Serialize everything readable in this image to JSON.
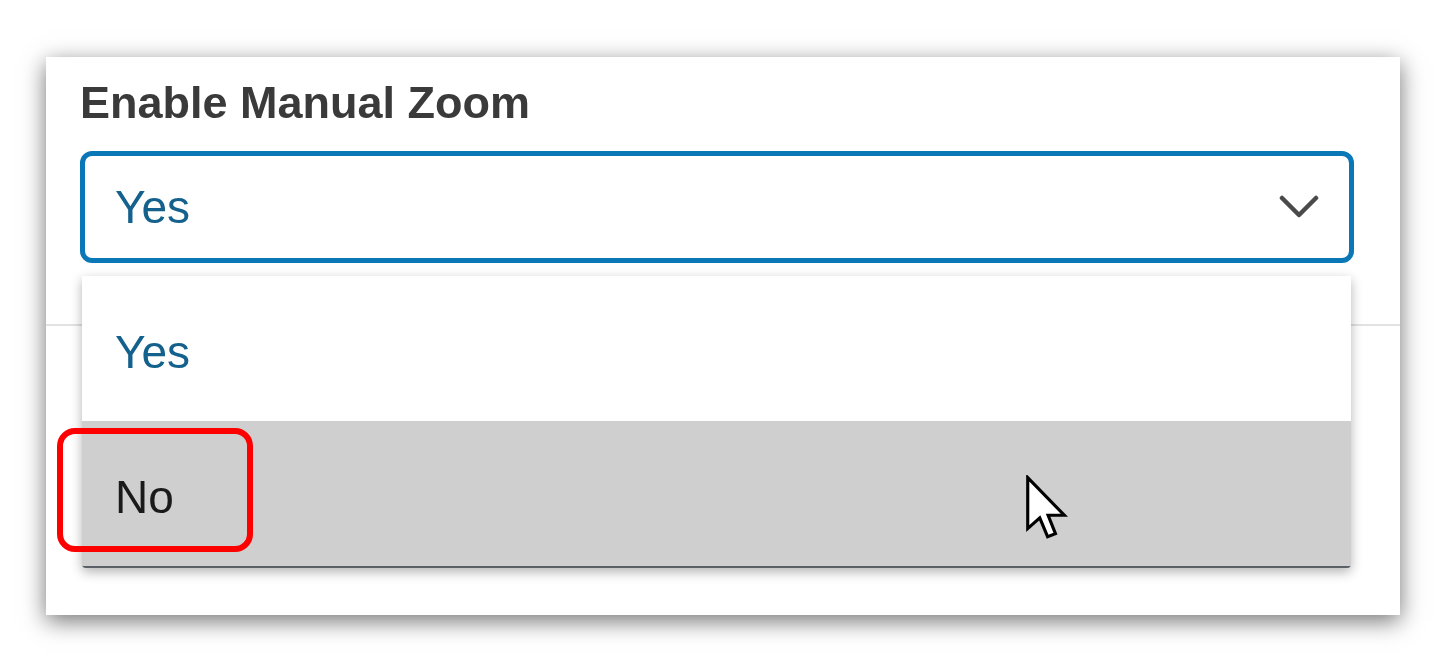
{
  "field": {
    "label": "Enable Manual Zoom",
    "value": "Yes",
    "focused": true,
    "expanded": true
  },
  "options": [
    {
      "label": "Yes",
      "selected": true,
      "hovered": false,
      "annotated": false
    },
    {
      "label": "No",
      "selected": false,
      "hovered": true,
      "annotated": true
    }
  ]
}
